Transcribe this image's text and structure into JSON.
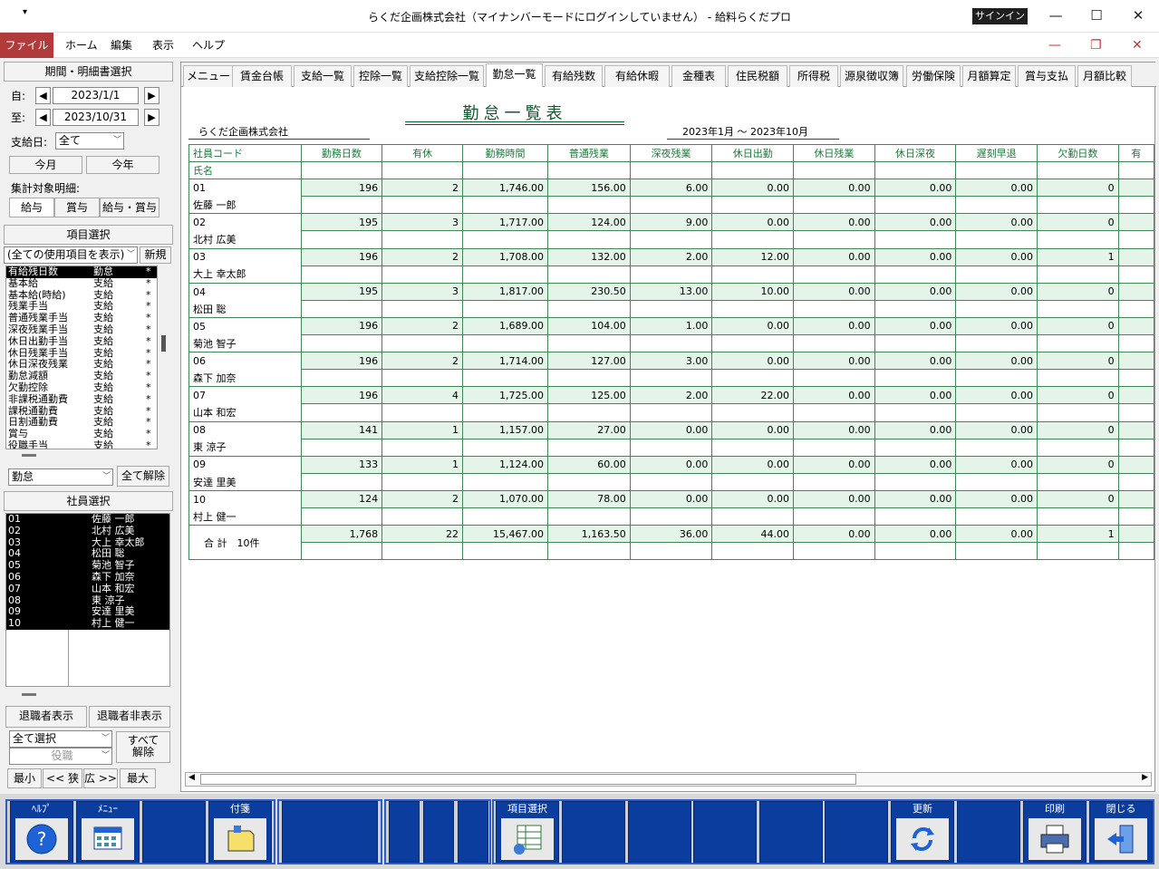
{
  "window": {
    "title": "らくだ企画株式会社（マイナンバーモードにログインしていません） - 給料らくだプロ",
    "signin": "サインイン",
    "min": "—",
    "max": "☐",
    "close": "✕",
    "quick_access": "▾"
  },
  "menubar": {
    "file": "ファイル",
    "items": [
      "ホーム",
      "編集",
      "表示",
      "ヘルプ"
    ],
    "min": "—",
    "restore": "❐",
    "close": "✕"
  },
  "left": {
    "period_header": "期間・明細書選択",
    "from_label": "自:",
    "from_date": "2023/1/1",
    "to_label": "至:",
    "to_date": "2023/10/31",
    "payday_label": "支給日:",
    "payday_value": "全て",
    "this_month": "今月",
    "this_year": "今年",
    "target_label": "集計対象明細:",
    "target_buttons": [
      "給与",
      "賞与",
      "給与・賞与"
    ],
    "item_header": "項目選択",
    "item_filter": "(全ての使用項目を表示)",
    "new_button": "新規",
    "items": [
      [
        "有給残日数",
        "勤怠",
        "*"
      ],
      [
        "基本給",
        "支給",
        "*"
      ],
      [
        "基本給(時給)",
        "支給",
        "*"
      ],
      [
        "残業手当",
        "支給",
        "*"
      ],
      [
        "普通残業手当",
        "支給",
        "*"
      ],
      [
        "深夜残業手当",
        "支給",
        "*"
      ],
      [
        "休日出勤手当",
        "支給",
        "*"
      ],
      [
        "休日残業手当",
        "支給",
        "*"
      ],
      [
        "休日深夜残業",
        "支給",
        "*"
      ],
      [
        "勤怠減額",
        "支給",
        "*"
      ],
      [
        "欠勤控除",
        "支給",
        "*"
      ],
      [
        "非課税通勤費",
        "支給",
        "*"
      ],
      [
        "課税通勤費",
        "支給",
        "*"
      ],
      [
        "日割通勤費",
        "支給",
        "*"
      ],
      [
        "賞与",
        "支給",
        "*"
      ],
      [
        "役職手当",
        "支給",
        "*"
      ]
    ],
    "category_value": "勤怠",
    "clear_all": "全て解除",
    "employee_header": "社員選択",
    "employees": [
      [
        "01",
        "佐藤 一郎"
      ],
      [
        "02",
        "北村 広美"
      ],
      [
        "03",
        "大上 幸太郎"
      ],
      [
        "04",
        "松田 聡"
      ],
      [
        "05",
        "菊池 智子"
      ],
      [
        "06",
        "森下 加奈"
      ],
      [
        "07",
        "山本 和宏"
      ],
      [
        "08",
        "東 涼子"
      ],
      [
        "09",
        "安達 里美"
      ],
      [
        "10",
        "村上 健一"
      ]
    ],
    "show_retired": "退職者表示",
    "hide_retired": "退職者非表示",
    "select_all": "全て選択",
    "position": "役職",
    "release_all": "すべて\n解除",
    "zoom": [
      "最小",
      "<< 狭",
      "広 >>",
      "最大"
    ]
  },
  "tabs": [
    "メニュー",
    "賃金台帳",
    "支給一覧",
    "控除一覧",
    "支給控除一覧",
    "勤怠一覧",
    "有給残数",
    "有給休暇",
    "金種表",
    "住民税額",
    "所得税",
    "源泉徴収簿",
    "労働保険",
    "月額算定",
    "賞与支払",
    "月額比較"
  ],
  "active_tab": 5,
  "report": {
    "title": "勤怠一覧表",
    "company": "らくだ企画株式会社",
    "period": "2023年1月 ～ 2023年10月",
    "header_code": "社員コード",
    "header_name": "氏名",
    "columns": [
      "勤務日数",
      "有休",
      "勤務時間",
      "普通残業",
      "深夜残業",
      "休日出勤",
      "休日残業",
      "休日深夜",
      "遅刻早退",
      "欠勤日数",
      "有"
    ],
    "rows": [
      {
        "code": "01",
        "name": "佐藤 一郎",
        "values": [
          "196",
          "2",
          "1,746.00",
          "156.00",
          "6.00",
          "0.00",
          "0.00",
          "0.00",
          "0.00",
          "0",
          ""
        ]
      },
      {
        "code": "02",
        "name": "北村 広美",
        "values": [
          "195",
          "3",
          "1,717.00",
          "124.00",
          "9.00",
          "0.00",
          "0.00",
          "0.00",
          "0.00",
          "0",
          ""
        ]
      },
      {
        "code": "03",
        "name": "大上 幸太郎",
        "values": [
          "196",
          "2",
          "1,708.00",
          "132.00",
          "2.00",
          "12.00",
          "0.00",
          "0.00",
          "0.00",
          "1",
          ""
        ]
      },
      {
        "code": "04",
        "name": "松田 聡",
        "values": [
          "195",
          "3",
          "1,817.00",
          "230.50",
          "13.00",
          "10.00",
          "0.00",
          "0.00",
          "0.00",
          "0",
          ""
        ]
      },
      {
        "code": "05",
        "name": "菊池 智子",
        "values": [
          "196",
          "2",
          "1,689.00",
          "104.00",
          "1.00",
          "0.00",
          "0.00",
          "0.00",
          "0.00",
          "0",
          ""
        ]
      },
      {
        "code": "06",
        "name": "森下 加奈",
        "values": [
          "196",
          "2",
          "1,714.00",
          "127.00",
          "3.00",
          "0.00",
          "0.00",
          "0.00",
          "0.00",
          "0",
          ""
        ]
      },
      {
        "code": "07",
        "name": "山本 和宏",
        "values": [
          "196",
          "4",
          "1,725.00",
          "125.00",
          "2.00",
          "22.00",
          "0.00",
          "0.00",
          "0.00",
          "0",
          ""
        ]
      },
      {
        "code": "08",
        "name": "東 涼子",
        "values": [
          "141",
          "1",
          "1,157.00",
          "27.00",
          "0.00",
          "0.00",
          "0.00",
          "0.00",
          "0.00",
          "0",
          ""
        ]
      },
      {
        "code": "09",
        "name": "安達 里美",
        "values": [
          "133",
          "1",
          "1,124.00",
          "60.00",
          "0.00",
          "0.00",
          "0.00",
          "0.00",
          "0.00",
          "0",
          ""
        ]
      },
      {
        "code": "10",
        "name": "村上 健一",
        "values": [
          "124",
          "2",
          "1,070.00",
          "78.00",
          "0.00",
          "0.00",
          "0.00",
          "0.00",
          "0.00",
          "0",
          ""
        ]
      }
    ],
    "total_label": "合 計　10件",
    "total": [
      "1,768",
      "22",
      "15,467.00",
      "1,163.50",
      "36.00",
      "44.00",
      "0.00",
      "0.00",
      "0.00",
      "1",
      ""
    ]
  },
  "toolbar": {
    "help": "ﾍﾙﾌﾟ",
    "menu": "ﾒﾆｭｰ",
    "note": "付箋",
    "item_select": "項目選択",
    "refresh": "更新",
    "print": "印刷",
    "close": "閉じる"
  },
  "colors": {
    "accent_red": "#b13b3b",
    "grid_green": "#3d8a55",
    "row_tint": "#e4f4e8",
    "toolbar_blue": "#0b3d9e"
  }
}
